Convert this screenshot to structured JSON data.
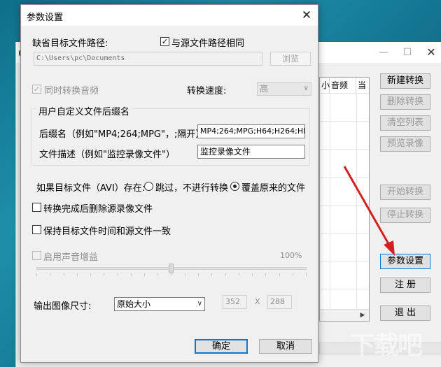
{
  "main_window": {
    "list_columns": [
      "小",
      "音频",
      "当"
    ],
    "buttons": {
      "new_convert": "新建转换",
      "delete_convert": "删除转换",
      "clear_list": "清空列表",
      "preview": "预览录像",
      "start_convert": "开始转换",
      "stop_convert": "停止转换",
      "settings": "参数设置",
      "register": "注 册",
      "exit": "退 出"
    }
  },
  "dialog": {
    "title": "参数设置",
    "default_path_label": "缺省目标文件路径:",
    "same_as_source_label": "与源文件路径相同",
    "path_value": "C:\\Users\\pc\\Documents",
    "browse_label": "浏览",
    "sync_audio_label": "同时转换音频",
    "speed_label": "转换速度:",
    "speed_value": "高",
    "suffix_group_title": "用户自定义文件后缀名",
    "suffix_label": "后缀名（例如\"MP4;264;MPG\"，;隔开）",
    "suffix_value": "MP4;264;MPG;H64;H264;HE4",
    "desc_label": "文件描述（例如\"监控录像文件\"）",
    "desc_value": "监控录像文件",
    "exists_label": "如果目标文件（AVI）存在:",
    "skip_label": "跳过，不进行转换",
    "overwrite_label": "覆盖原来的文件",
    "delete_source_label": "转换完成后删除源录像文件",
    "keep_time_label": "保持目标文件时间和源文件一致",
    "enable_gain_label": "启用声音增益",
    "gain_percent": "100%",
    "gain_level": 0.5,
    "output_size_label": "输出图像尺寸:",
    "output_size_value": "原始大小",
    "width_value": "352",
    "x_label": "X",
    "height_value": "288",
    "ok_label": "确定",
    "cancel_label": "取消"
  },
  "watermark": "下载吧",
  "colors": {
    "arrow": "#d42020",
    "focus_border": "#0078d7"
  }
}
